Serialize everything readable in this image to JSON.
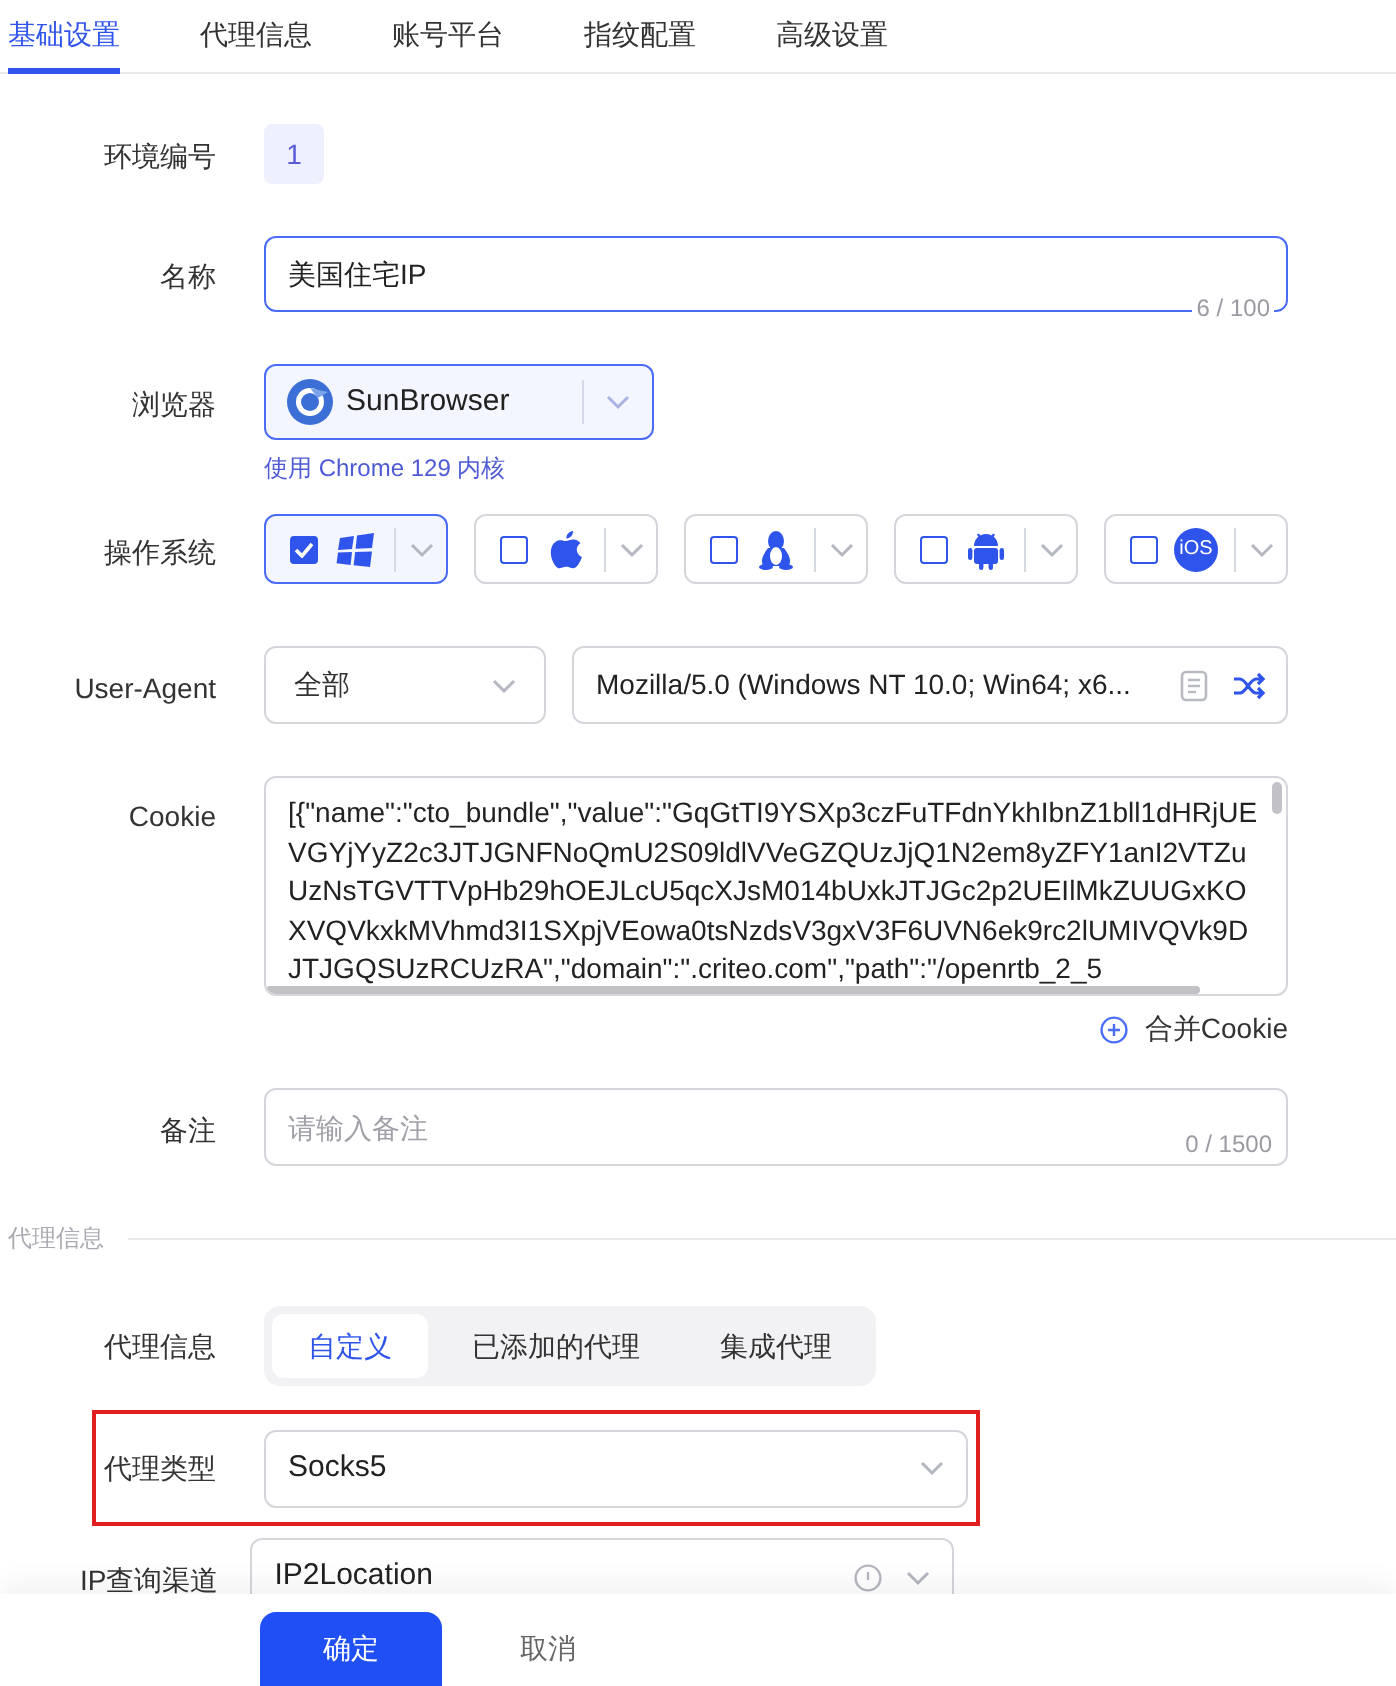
{
  "tabs": [
    {
      "label": "基础设置",
      "selected": true
    },
    {
      "label": "代理信息",
      "selected": false
    },
    {
      "label": "账号平台",
      "selected": false
    },
    {
      "label": "指纹配置",
      "selected": false
    },
    {
      "label": "高级设置",
      "selected": false
    }
  ],
  "form": {
    "env_number": {
      "label": "环境编号",
      "value": "1"
    },
    "name": {
      "label": "名称",
      "value": "美国住宅IP",
      "counter": "6 / 100",
      "focused": true
    },
    "browser": {
      "label": "浏览器",
      "value": "SunBrowser",
      "hint": "使用 Chrome 129 内核"
    },
    "os": {
      "label": "操作系统",
      "options": [
        {
          "kind": "windows",
          "checked": true,
          "selected": true
        },
        {
          "kind": "apple",
          "checked": false,
          "selected": false
        },
        {
          "kind": "linux",
          "checked": false,
          "selected": false
        },
        {
          "kind": "android",
          "checked": false,
          "selected": false
        },
        {
          "kind": "ios",
          "label": "iOS",
          "checked": false,
          "selected": false
        }
      ]
    },
    "user_agent": {
      "label": "User-Agent",
      "filter": "全部",
      "value": "Mozilla/5.0 (Windows NT 10.0; Win64; x6..."
    },
    "cookie": {
      "label": "Cookie",
      "value": "[{\"name\":\"cto_bundle\",\"value\":\"GqGtTI9YSXp3czFuTFdnYkhIbnZ1bll1dHRjUEVGYjYyZ2c3JTJGNFNoQmU2S09ldlVVeGZQUzJjQ1N2em8yZFY1anI2VTZuUzNsTGVTTVpHb29hOEJLcU5qcXJsM014bUxkJTJGc2p2UEIlMkZUUGxKOXVQVkxkMVhmd3I1SXpjVEowa0tsNzdsV3gxV3F6UVN6ek9rc2lUMIVQVk9DJTJGQSUzRCUzRA\",\"domain\":\".criteo.com\",\"path\":\"/openrtb_2_5",
      "merge_button": "合并Cookie"
    },
    "remarks": {
      "label": "备注",
      "placeholder": "请输入备注",
      "counter": "0 / 1500"
    }
  },
  "proxy_section": {
    "title": "代理信息",
    "proxy_info": {
      "label": "代理信息",
      "options": [
        {
          "label": "自定义",
          "selected": true
        },
        {
          "label": "已添加的代理",
          "selected": false
        },
        {
          "label": "集成代理",
          "selected": false
        }
      ]
    },
    "proxy_type": {
      "label": "代理类型",
      "value": "Socks5",
      "highlighted": true
    },
    "ip_channel": {
      "label": "IP查询渠道",
      "value": "IP2Location"
    }
  },
  "footer": {
    "buttons": [
      {
        "label": "确定",
        "kind": "primary"
      },
      {
        "label": "取消",
        "kind": "text"
      }
    ]
  }
}
